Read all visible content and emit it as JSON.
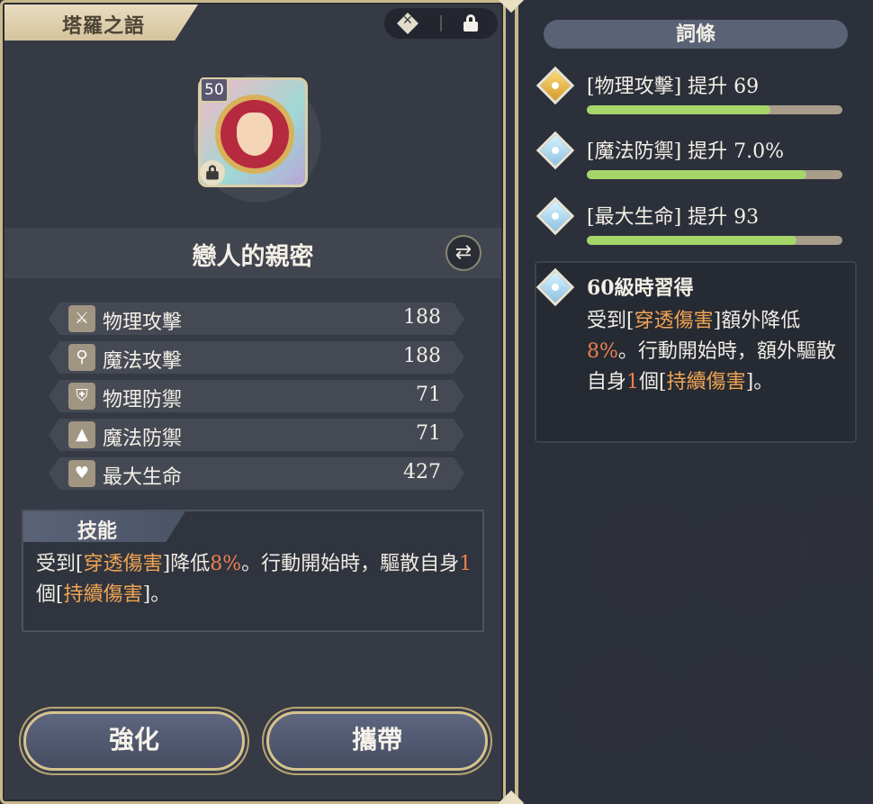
{
  "panel_title": "塔羅之語",
  "item": {
    "level": "50",
    "name": "戀人的親密"
  },
  "stats": [
    {
      "icon": "sword-icon",
      "label": "物理攻擊",
      "value": "188"
    },
    {
      "icon": "wand-icon",
      "label": "魔法攻擊",
      "value": "188"
    },
    {
      "icon": "shield-icon",
      "label": "物理防禦",
      "value": "71"
    },
    {
      "icon": "wizard-hat-icon",
      "label": "魔法防禦",
      "value": "71"
    },
    {
      "icon": "heart-icon",
      "label": "最大生命",
      "value": "427"
    }
  ],
  "skill": {
    "header": "技能",
    "p1": "受到[",
    "h1": "穿透傷害",
    "p2": "]降低",
    "n1": "8%",
    "p3": "。行動開始時，驅散自身",
    "n2": "1",
    "p4": "個[",
    "h2": "持續傷害",
    "p5": "]。"
  },
  "buttons": {
    "enhance": "強化",
    "equip": "攜帶"
  },
  "affixes": {
    "header": "詞條",
    "items": [
      {
        "text": "[物理攻擊] 提升 69",
        "progress": 0.72,
        "gem": "gold"
      },
      {
        "text": "[魔法防禦] 提升 7.0%",
        "progress": 0.86,
        "gem": "blue"
      },
      {
        "text": "[最大生命] 提升 93",
        "progress": 0.82,
        "gem": "blue"
      }
    ],
    "unlock": {
      "title": "60級時習得",
      "p1": "受到[",
      "h1": "穿透傷害",
      "p2": "]額外降低",
      "n1": "8%",
      "p3": "。行動開始時，額外驅散自身",
      "n2": "1",
      "p4": "個[",
      "h2": "持續傷害",
      "p5": "]。"
    }
  },
  "colors": {
    "highlight": "#f0a553",
    "number": "#ec7f50",
    "frame_gold": "#c9b98a",
    "bar_fill": "#a6d66a"
  }
}
